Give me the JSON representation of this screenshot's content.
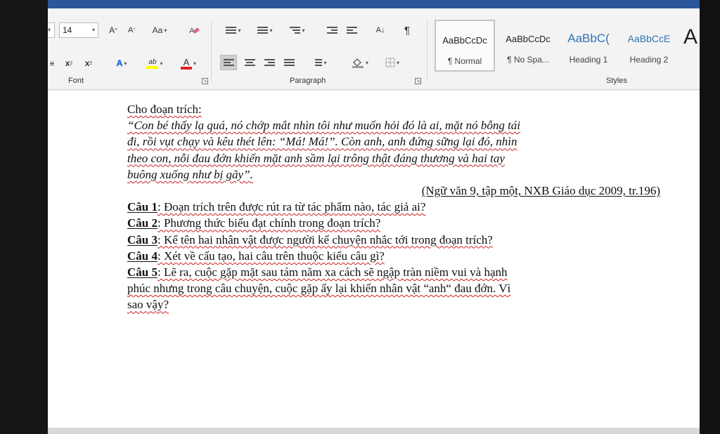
{
  "ribbon": {
    "font": {
      "label": "Font",
      "size": "14",
      "grow_glyph": "A",
      "shrink_glyph": "A",
      "case_label": "Aa",
      "subscript_glyph": "x",
      "superscript_glyph": "x",
      "strike_glyph": "x",
      "font_color_glyph": "A",
      "highlight_glyph": "ab",
      "effects_glyph": "A"
    },
    "paragraph": {
      "label": "Paragraph",
      "sort_glyph": "A↓",
      "pilcrow_glyph": "¶"
    },
    "styles": {
      "label": "Styles",
      "items": [
        {
          "sample": "AaBbCcDc",
          "name": "¶ Normal"
        },
        {
          "sample": "AaBbCcDc",
          "name": "¶ No Spa..."
        },
        {
          "sample": "AaBbC(",
          "name": "Heading 1"
        },
        {
          "sample": "AaBbCcE",
          "name": "Heading 2"
        }
      ],
      "overflow_glyph": "A"
    },
    "colors": {
      "accent": "#2b579a",
      "font_color": "#e02020",
      "highlight": "#ffff00",
      "heading": "#2e74b5",
      "spell": "#d02020",
      "grammar": "#2f5fd0"
    }
  },
  "document": {
    "intro": "Cho đoạn trích:",
    "quote_lines": [
      "“Con bé thấy lạ quá, nó chớp mắt nhìn tôi như muốn hỏi đó là ai, mặt nó bỗng tái",
      "đi, rồi vụt chạy và kêu thét lên: “Má! Má!”. Còn anh, anh đứng sững lại đó, nhìn",
      "theo con, nỗi đau đớn khiến mặt anh sầm lại trông thật đáng thương và hai tay",
      "buông xuống như bị gãy”."
    ],
    "source": "(Ngữ văn 9, tập một, NXB Giáo dục 2009, tr.196)",
    "questions": [
      {
        "label": "Câu 1",
        "text": ": Đoạn trích trên được rút ra từ tác phẩm nào, tác giả ai?"
      },
      {
        "label": "Câu 2",
        "text": ": Phương thức biểu đạt chính trong đoạn trích?"
      },
      {
        "label": "Câu 3",
        "text": ": Kể tên hai nhân vật được người kể chuyện nhắc tới trong đoạn trích?"
      },
      {
        "label": "Câu 4",
        "text": ": Xét về cấu tạo, hai câu trên thuộc kiểu câu gì?"
      },
      {
        "label": "Câu 5",
        "text": ": Lẽ ra, cuộc gặp mặt sau tám năm xa cách sẽ ngập tràn niềm vui và hạnh"
      }
    ],
    "question5_cont": [
      "phúc nhưng trong câu chuyện, cuộc gặp ấy lại khiến nhân vật “anh“ đau đớn. Vì",
      "sao vậy?"
    ]
  }
}
